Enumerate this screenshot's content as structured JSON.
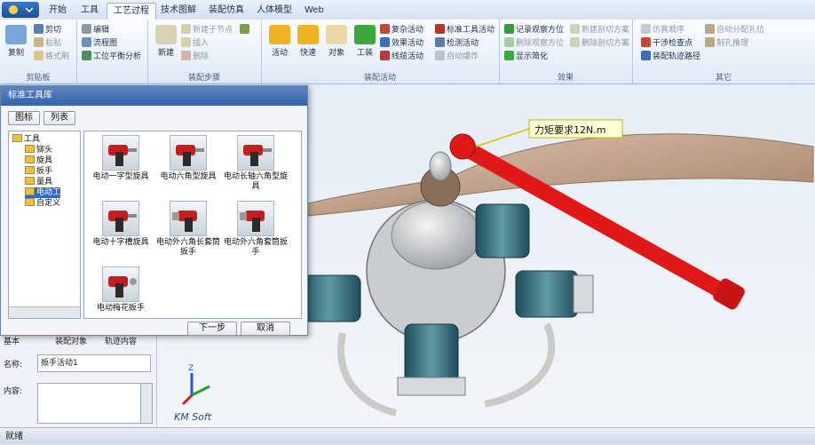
{
  "tabs": [
    "开始",
    "工具",
    "工艺过程",
    "技术图解",
    "装配仿真",
    "人体模型",
    "Web"
  ],
  "active_tab_index": 2,
  "ribbon": {
    "clipboard": {
      "copy": "复制",
      "cut": "剪切",
      "paste": "粘贴",
      "format_brush": "格式刷",
      "label": "剪贴板"
    },
    "doc": {
      "edit": "编辑",
      "flowchart": "流程图",
      "balance": "工位平衡分析"
    },
    "steps": {
      "new": "新建",
      "new_child": "新建子节点",
      "insert": "插入",
      "delete": "删除",
      "label": "装配步骤"
    },
    "activity": {
      "activity": "活动",
      "quick": "快速",
      "object": "对象",
      "tool": "工装",
      "complex": "复杂活动",
      "effect": "效果活动",
      "line": "线缆活动",
      "std_tool": "标准工具活动",
      "check": "检测活动",
      "auto": "自动爆炸",
      "label": "装配活动"
    },
    "effect": {
      "record": "记录观察方位",
      "delete_view": "删除观察方位",
      "simplify": "显示简化",
      "new_cut": "新建剖切方案",
      "delete_cut": "删除剖切方案",
      "label": "效果"
    },
    "other": {
      "sim_order": "仿真顺序",
      "interference": "干涉检查点",
      "path": "装配轨迹路径",
      "auto_hole": "自动分配孔位",
      "reverse": "制孔推理",
      "label": "其它"
    }
  },
  "dialog": {
    "title": "标准工具库",
    "view_icon": "图标",
    "view_list": "列表",
    "tree": {
      "root": "工具",
      "items": [
        "铆头",
        "旋具",
        "扳手",
        "量具",
        "电动工",
        "自定义"
      ]
    },
    "tools": [
      {
        "name": "电动一字型旋具"
      },
      {
        "name": "电动六角型旋具"
      },
      {
        "name": "电动长轴六角型旋具"
      },
      {
        "name": "电动十字槽旋具"
      },
      {
        "name": "电动外六角长套筒扳手"
      },
      {
        "name": "电动外六角套筒扳手"
      },
      {
        "name": "电动梅花扳手"
      }
    ],
    "next": "下一步",
    "cancel": "取消"
  },
  "left_panel": {
    "tabs": [
      "基本",
      "装配对象",
      "轨迹内容"
    ],
    "name_label": "名称:",
    "name_value": "扳手活动1",
    "content_label": "内容:"
  },
  "viewport": {
    "annotation": "力矩要求12N.m",
    "brand": "KM Soft",
    "axis": "Z"
  },
  "status": "就绪",
  "colors": {
    "wrench": "#e01818",
    "cylinder": "#2e6b78",
    "ribbon_bg": "#e4edf8"
  }
}
